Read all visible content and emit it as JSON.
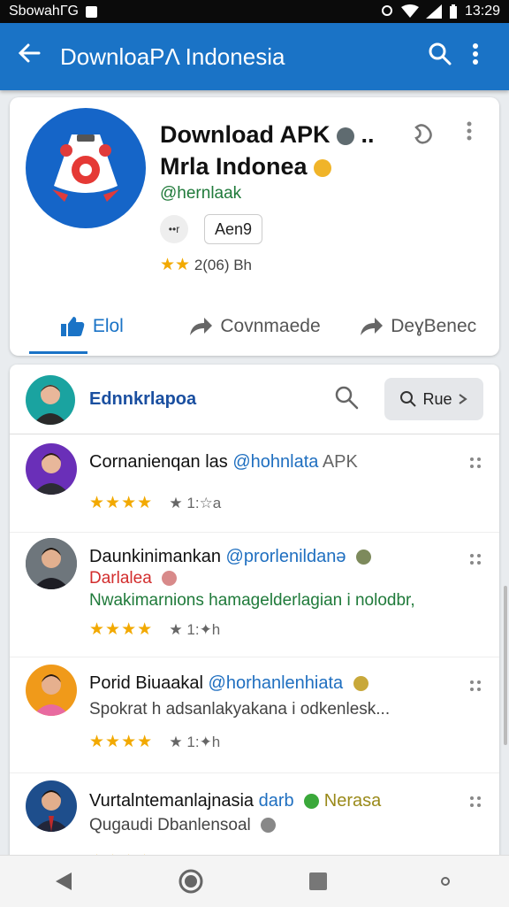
{
  "status_bar": {
    "left_text": "SbowahГG",
    "time": "13:29"
  },
  "app_bar": {
    "title": "DownloaPΛ Indonesia",
    "back_icon": "arrow-left-icon",
    "search_icon": "search-icon",
    "more_icon": "more-vert-icon"
  },
  "app_card": {
    "title_line1": "Download APK",
    "title_line1_suffix": "..",
    "title_line2": "Mrla Indonea",
    "handle": "@hernlaak",
    "sound_chip": "••r",
    "age_chip": "Aen9",
    "rating_stars": "★★",
    "rating_text": "2(06) Bh",
    "tabs": [
      {
        "label": "Elol",
        "icon": "thumbs-up-icon"
      },
      {
        "label": "Covnmaede",
        "icon": "share-arrow-icon"
      },
      {
        "label": "DeɣBenec",
        "icon": "share-arrow-icon"
      }
    ]
  },
  "list": {
    "header_title": "Ednnkrlapoa",
    "header_button": "Rue",
    "items": [
      {
        "name": "Cornanienqan las",
        "mention": "@hohnlata",
        "suffix": "APK",
        "line": "",
        "line_color": "",
        "line2": "",
        "stars": "★★★★",
        "rating_text": "★ 1:☆a",
        "avatar_bg": "#6a2fb8"
      },
      {
        "name": "Daunkinimankan",
        "mention": "@prorlenildanə",
        "suffix": "",
        "line": "Darlalea",
        "line_color": "#d22d2d",
        "line2": "Nwakimarnions hamagelderlagian i nolodbr,",
        "stars": "★★★★",
        "rating_text": "★ 1:✦h",
        "avatar_bg": "#555e66"
      },
      {
        "name": "Porid Biuaakal",
        "mention": "@horhanlenhiata",
        "suffix": "",
        "line": "Spokrat h adsanlakyakana i odkenlesk...",
        "line_color": "#444444",
        "line2": "",
        "stars": "★★★★",
        "rating_text": "★ 1:✦h",
        "avatar_bg": "#f09a1a"
      },
      {
        "name": "Vurtalntemanlajnasia",
        "mention": "darb",
        "suffix": "Nerasa",
        "line": "Qugaudi Dbanlensoal",
        "line_color": "#444444",
        "line2": "",
        "stars": "★★★★",
        "rating_text": "★ ★",
        "avatar_bg": "#1e4e8c"
      }
    ]
  },
  "colors": {
    "primary": "#1a73c6",
    "star": "#f2a900",
    "handle_green": "#1f7a3a"
  }
}
